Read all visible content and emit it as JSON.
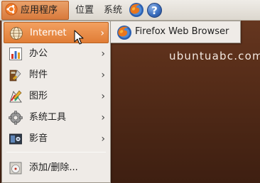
{
  "desktop": {
    "watermark": "ubuntuabc.com"
  },
  "panel": {
    "applications_label": "应用程序",
    "places_label": "位置",
    "system_label": "系统",
    "firefox_icon": "firefox-icon",
    "help_icon": "help-icon",
    "help_glyph": "?"
  },
  "menu": {
    "items": [
      {
        "label": "Internet",
        "icon": "globe-icon",
        "has_submenu": true,
        "active": true
      },
      {
        "label": "办公",
        "icon": "office-chart-icon",
        "has_submenu": true
      },
      {
        "label": "附件",
        "icon": "accessories-icon",
        "has_submenu": true
      },
      {
        "label": "图形",
        "icon": "graphics-icon",
        "has_submenu": true
      },
      {
        "label": "系统工具",
        "icon": "gear-icon",
        "has_submenu": true
      },
      {
        "label": "影音",
        "icon": "multimedia-icon",
        "has_submenu": true
      },
      {
        "label": "添加/删除...",
        "icon": "install-disc-icon",
        "has_submenu": false
      }
    ],
    "arrow_glyph": "›"
  },
  "submenu": {
    "items": [
      {
        "label": "Firefox Web Browser",
        "icon": "firefox-icon"
      }
    ]
  },
  "colors": {
    "accent": "#e07d36",
    "menu_bg": "#efebe7",
    "panel_bg": "#dcd7ce",
    "desktop_bg": "#5a2f1a"
  }
}
